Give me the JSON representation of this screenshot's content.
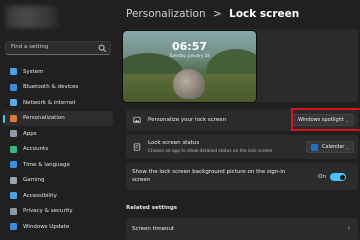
{
  "sidebar": {
    "search_placeholder": "Find a setting",
    "items": [
      {
        "label": "System",
        "icon": "monitor-icon",
        "color": "#4aa3e8",
        "active": false
      },
      {
        "label": "Bluetooth & devices",
        "icon": "bluetooth-icon",
        "color": "#3b8ddd",
        "active": false
      },
      {
        "label": "Network & internet",
        "icon": "wifi-icon",
        "color": "#5aa9e6",
        "active": false
      },
      {
        "label": "Personalization",
        "icon": "brush-icon",
        "color": "#e07a3c",
        "active": true
      },
      {
        "label": "Apps",
        "icon": "apps-icon",
        "color": "#8a9bb0",
        "active": false
      },
      {
        "label": "Accounts",
        "icon": "person-icon",
        "color": "#3fb27f",
        "active": false
      },
      {
        "label": "Time & language",
        "icon": "globe-clock-icon",
        "color": "#3b8ddd",
        "active": false
      },
      {
        "label": "Gaming",
        "icon": "gamepad-icon",
        "color": "#9aa4ae",
        "active": false
      },
      {
        "label": "Accessibility",
        "icon": "accessibility-icon",
        "color": "#4aa3e8",
        "active": false
      },
      {
        "label": "Privacy & security",
        "icon": "shield-icon",
        "color": "#8f9aa6",
        "active": false
      },
      {
        "label": "Windows Update",
        "icon": "update-icon",
        "color": "#3b8ddd",
        "active": false
      }
    ]
  },
  "header": {
    "parent": "Personalization",
    "separator": ">",
    "current": "Lock screen"
  },
  "preview": {
    "time": "06:57",
    "date": "Tuesday, January 18"
  },
  "settings": {
    "personalize": {
      "title": "Personalize your lock screen",
      "value": "Windows spotlight"
    },
    "status": {
      "title": "Lock screen status",
      "subtitle": "Choose an app to show detailed status on the lock screen",
      "value": "Calendar"
    },
    "signin": {
      "title_line1": "Show the lock screen background picture on the sign-in",
      "title_line2": "screen",
      "toggle_label": "On",
      "toggle_on": true
    }
  },
  "related": {
    "heading": "Related settings",
    "items": [
      {
        "label": "Screen timeout"
      }
    ]
  },
  "colors": {
    "accent": "#4cc2ff",
    "highlight_box": "#d8121f"
  }
}
